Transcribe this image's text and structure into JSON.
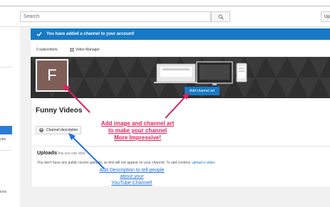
{
  "search": {
    "placeholder": "Search"
  },
  "header": {
    "upload_label": "Up"
  },
  "sidebar": {
    "label_partial_1": "ube",
    "label_partial_2": "ions"
  },
  "banner": {
    "message": "You have added a channel to your account!"
  },
  "stats": {
    "subscribers": "0 subscribers",
    "video_manager": "Video Manager"
  },
  "channel": {
    "avatar_letter": "F",
    "add_art_label": "Add channel art",
    "title": "Funny Videos",
    "description_button": "Channel description"
  },
  "uploads": {
    "heading": "Uploads",
    "visibility": "Only you can view",
    "message_prefix": "You don't have any public recent uploads, so this will not appear on your channel. To add content, ",
    "link": "upload a video."
  },
  "annotations": {
    "pink_line1": "Add image and channel art",
    "pink_line2": "to make your channel",
    "pink_line3": "More Impressive!",
    "blue_line1": "Add Description to tell people",
    "blue_line2": "about your",
    "blue_line3": "YouTube Channel!"
  },
  "colors": {
    "accent": "#167ac6",
    "annotation_pink": "#e2205c",
    "annotation_blue": "#1f6fe0",
    "avatar_bg": "#7d5f58"
  },
  "icons": [
    "search-icon",
    "check-icon",
    "video-manager-icon",
    "plus-circle-icon"
  ]
}
